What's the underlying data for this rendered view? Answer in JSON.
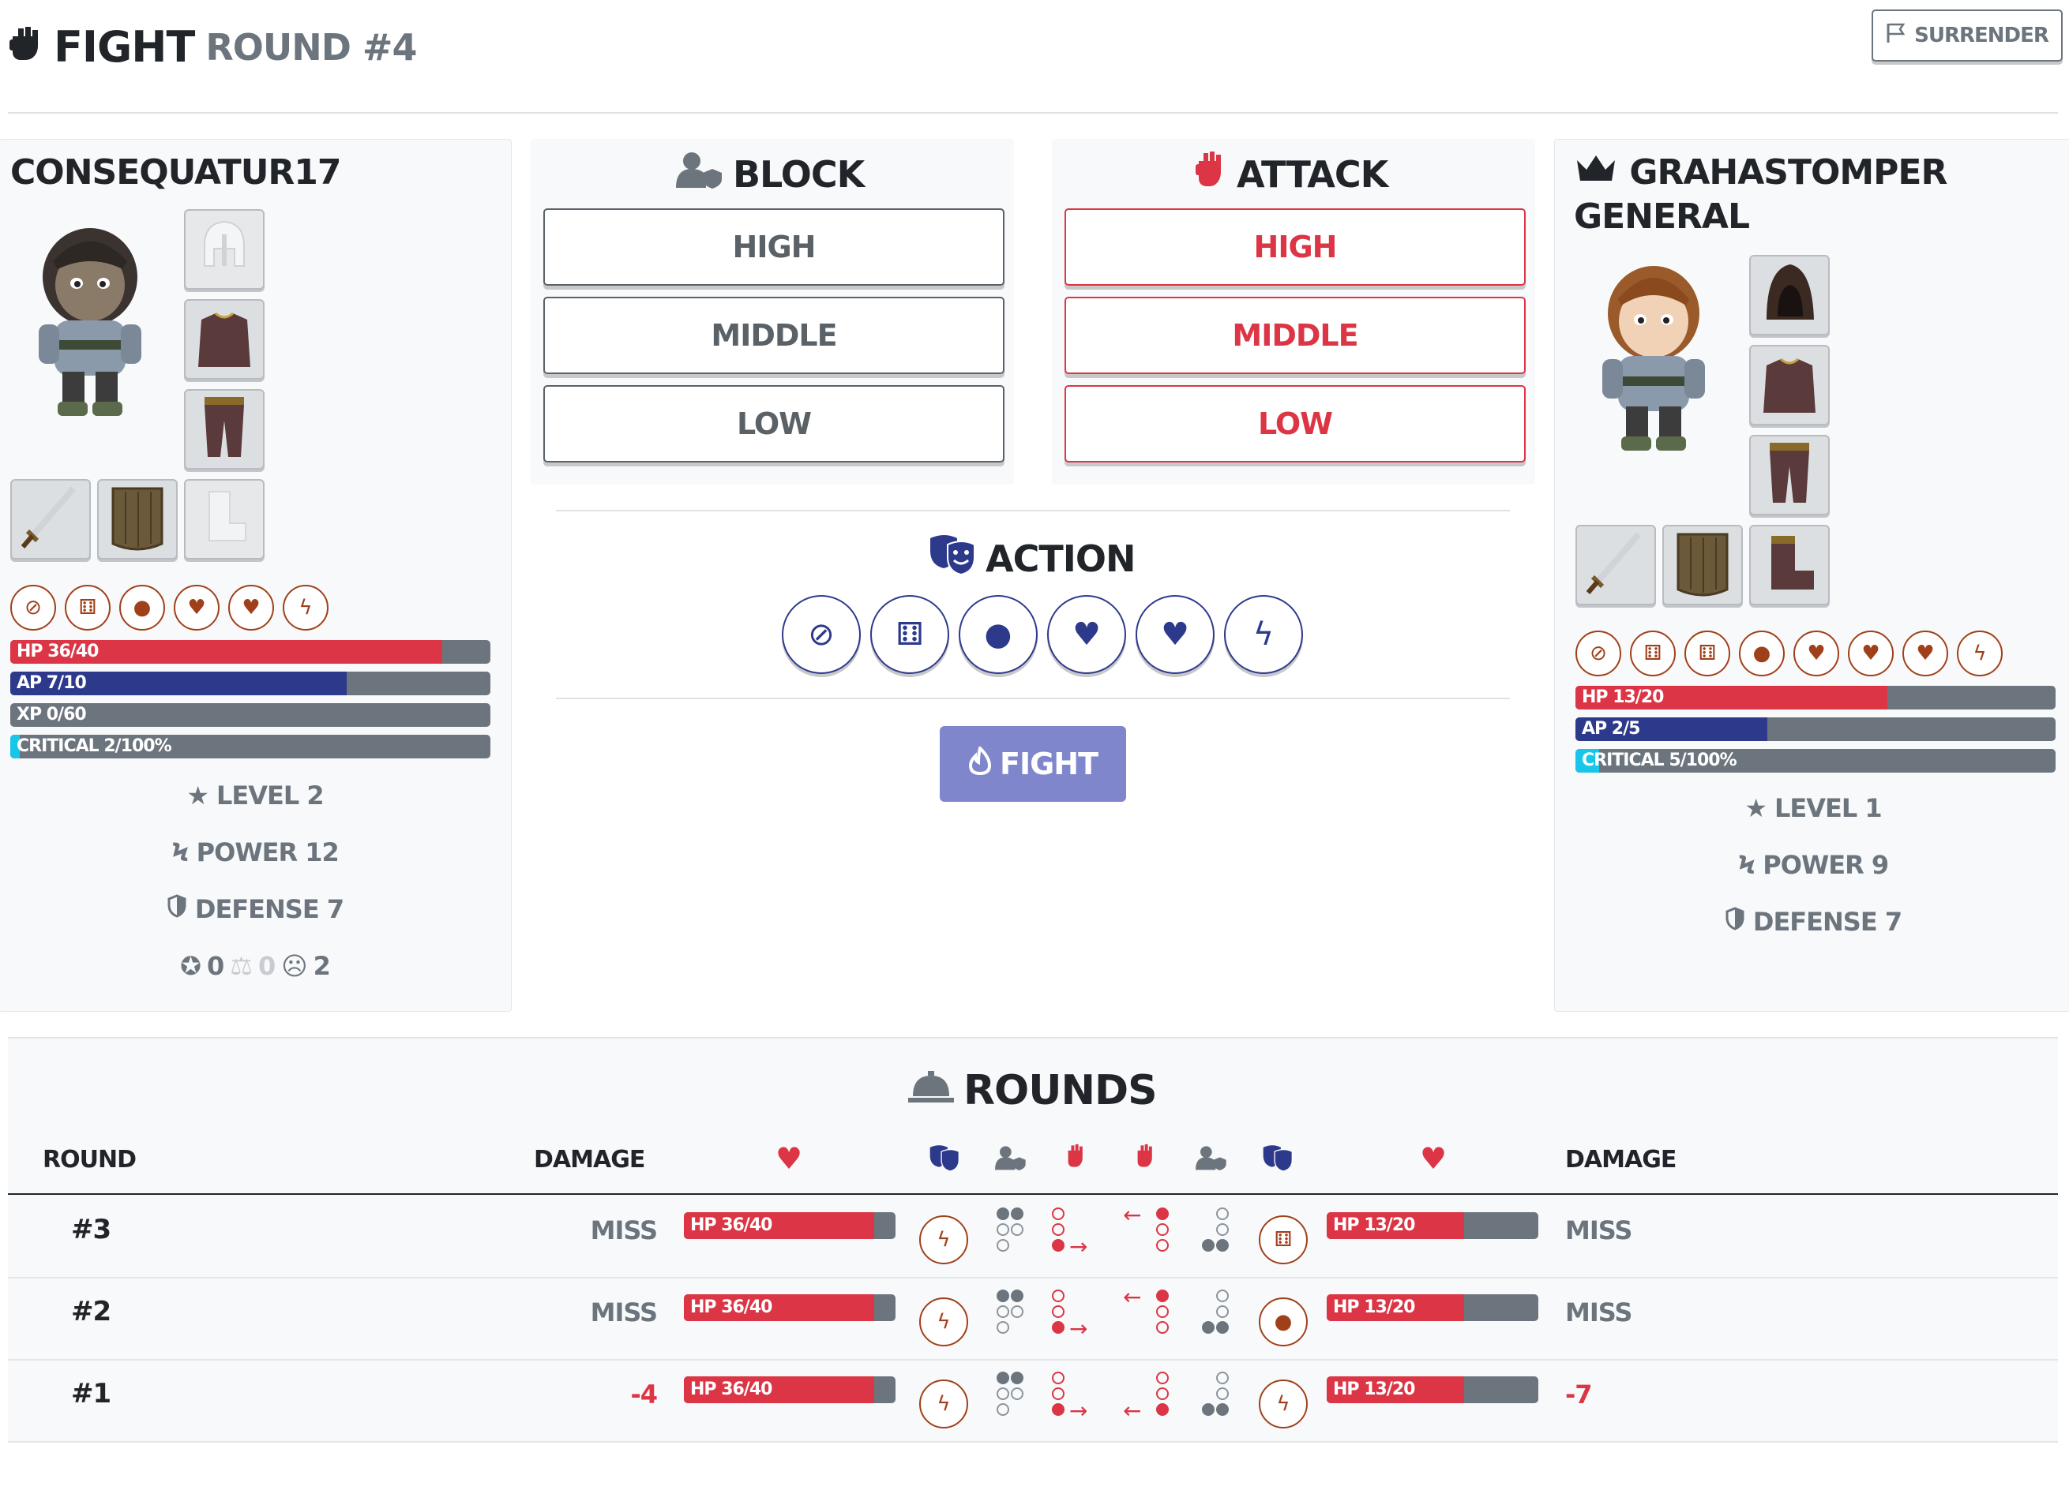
{
  "header": {
    "title": "Fight",
    "round_label": "round #4",
    "surrender_label": "Surrender",
    "fist_icon": "fist-icon",
    "flag_icon": "flag-icon"
  },
  "player": {
    "name": "Consequatur17",
    "hp": {
      "label": "HP 36/40",
      "value": 36,
      "max": 40
    },
    "ap": {
      "label": "AP 7/10",
      "value": 7,
      "max": 10
    },
    "xp": {
      "label": "XP 0/60",
      "value": 0,
      "max": 60
    },
    "critical": {
      "label": "Critical 2/100%",
      "value": 2,
      "max": 100
    },
    "level": "Level 2",
    "power": "Power 12",
    "defense": "Defense 7",
    "wins": "0",
    "draws": "0",
    "losses": "2",
    "skills": [
      "ban-icon",
      "dice-icon",
      "bomb-icon",
      "heart-crack-icon",
      "heart-icon",
      "bolt-icon"
    ]
  },
  "opponent": {
    "name_line1": "Grahastomper",
    "name_line2": "General",
    "hp": {
      "label": "HP 13/20",
      "value": 13,
      "max": 20
    },
    "ap": {
      "label": "AP 2/5",
      "value": 2,
      "max": 5
    },
    "critical": {
      "label": "Critical 5/100%",
      "value": 5,
      "max": 100
    },
    "level": "Level 1",
    "power": "Power 9",
    "defense": "Defense 7",
    "skills": [
      "ban-icon",
      "dice-icon",
      "dice-icon",
      "bomb-icon",
      "heart-crack-icon",
      "heart-icon",
      "heart-icon",
      "bolt-icon"
    ]
  },
  "block": {
    "title": "Block",
    "options": [
      "High",
      "Middle",
      "Low"
    ]
  },
  "attack": {
    "title": "Attack",
    "options": [
      "High",
      "Middle",
      "Low"
    ]
  },
  "action": {
    "title": "Action",
    "buttons": [
      "ban-icon",
      "dice-icon",
      "bomb-icon",
      "heart-crack-icon",
      "heart-icon",
      "bolt-icon"
    ]
  },
  "fight_button": "Fight",
  "rounds": {
    "title": "Rounds",
    "headers": {
      "round": "Round",
      "damage_left": "Damage",
      "damage_right": "Damage"
    },
    "rows": [
      {
        "round": "#3",
        "damage_left": "Miss",
        "hp_left": "HP 36/40",
        "hp_left_value": 36,
        "hp_left_max": 40,
        "action_left": "bolt-icon",
        "action_right": "dice-icon",
        "hp_right": "HP 13/20",
        "hp_right_value": 13,
        "hp_right_max": 20,
        "damage_right": "Miss"
      },
      {
        "round": "#2",
        "damage_left": "Miss",
        "hp_left": "HP 36/40",
        "hp_left_value": 36,
        "hp_left_max": 40,
        "action_left": "bolt-icon",
        "action_right": "bomb-icon",
        "hp_right": "HP 13/20",
        "hp_right_value": 13,
        "hp_right_max": 20,
        "damage_right": "Miss"
      },
      {
        "round": "#1",
        "damage_left": "-4",
        "hp_left": "HP 36/40",
        "hp_left_value": 36,
        "hp_left_max": 40,
        "action_left": "bolt-icon",
        "action_right": "bolt-icon",
        "hp_right": "HP 13/20",
        "hp_right_value": 13,
        "hp_right_max": 20,
        "damage_right": "-7"
      }
    ]
  },
  "colors": {
    "hp": "#dc3545",
    "ap": "#2d3a8c",
    "critical": "#17c6e8",
    "skill": "#a0401a",
    "action": "#2d3a8c",
    "fight_button": "#7f86cc"
  }
}
